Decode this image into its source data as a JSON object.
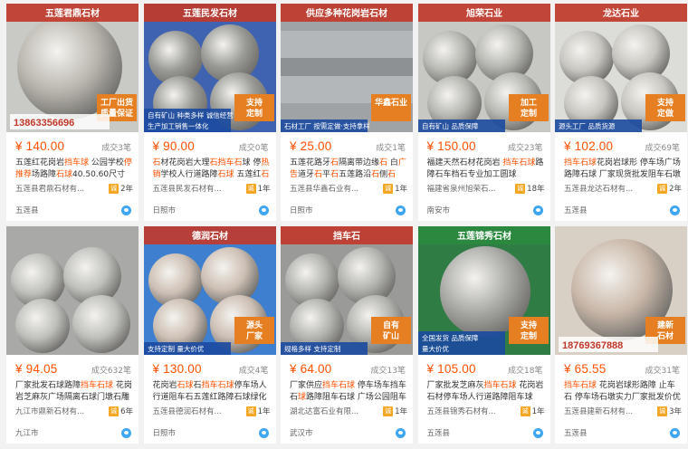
{
  "cards": [
    {
      "price": "¥ 140.00",
      "deals": "成交3笔",
      "title": [
        {
          "t": "五莲红花岗岩"
        },
        {
          "t": "挡车球",
          "h": true
        },
        {
          "t": " 公园学校"
        },
        {
          "t": "停",
          "h": true
        },
        {
          "t": "推荐",
          "h": true
        },
        {
          "t": "场路障"
        },
        {
          "t": "石球",
          "h": true
        },
        {
          "t": "40.50.60尺寸车止"
        },
        {
          "t": "石",
          "h": true
        }
      ],
      "seller": "五莲县君鼎石材有...",
      "years": "2年",
      "location": "五莲县",
      "img": {
        "bg": "#c9c9c6",
        "ball": "#b9b5ae",
        "banner_text": "五莲君鼎石材",
        "tag": "工厂出货\n质量保证",
        "phone": "13863356696"
      }
    },
    {
      "price": "¥ 90.00",
      "deals": "成交0笔",
      "title": [
        {
          "t": "石",
          "h": true
        },
        {
          "t": "材花岗岩大理"
        },
        {
          "t": "石挡车石",
          "h": true
        },
        {
          "t": "球 停"
        },
        {
          "t": "热销",
          "h": true
        },
        {
          "t": "学校人行道路障"
        },
        {
          "t": "石球",
          "h": true
        },
        {
          "t": " 五莲红"
        },
        {
          "t": "石",
          "h": true
        },
        {
          "t": "墩子"
        }
      ],
      "seller": "五莲县民发石材有...",
      "years": "1年",
      "location": "日照市",
      "img": {
        "bg": "#3f63b0",
        "ball": "#9a9a97",
        "banner_text": "五莲民发石材",
        "tag": "支持\n定制",
        "bottom": "自有矿山  种类多样  诚信经营\n生产加工销售一体化"
      }
    },
    {
      "price": "¥ 25.00",
      "deals": "成交1笔",
      "title": [
        {
          "t": "五莲花路牙"
        },
        {
          "t": "石",
          "h": true
        },
        {
          "t": "隔离带边缘"
        },
        {
          "t": "石",
          "h": true
        },
        {
          "t": " 白"
        },
        {
          "t": "广告",
          "h": true
        },
        {
          "t": "道牙"
        },
        {
          "t": "石",
          "h": true
        },
        {
          "t": "平"
        },
        {
          "t": "石",
          "h": true
        },
        {
          "t": "五莲路沿"
        },
        {
          "t": "石",
          "h": true
        },
        {
          "t": "侧"
        },
        {
          "t": "石",
          "h": true
        }
      ],
      "seller": "五莲县华鑫石业有...",
      "years": "1年",
      "location": "日照市",
      "img": {
        "bg": "#9fa3a6",
        "ball": "#8e9194",
        "banner_text": "供应多种花岗岩石材",
        "tag": "华鑫石业",
        "bottom": "石材工厂  按需定做·支持拿样"
      }
    },
    {
      "price": "¥ 150.00",
      "deals": "成交23笔",
      "title": [
        {
          "t": "福建天然石材花岗岩 "
        },
        {
          "t": "挡车",
          "h": true
        },
        {
          "t": "石",
          "h": true
        },
        {
          "t": "球",
          "h": true
        },
        {
          "t": "路障石车档石专业加工圆球"
        }
      ],
      "seller": "福建省泉州旭荣石...",
      "years": "18年",
      "location": "南安市",
      "img": {
        "bg": "#c7c8c4",
        "ball": "#b7b7b2",
        "banner_text": "旭荣石业",
        "tag": "加工\n定制",
        "bottom": "自有矿山  品质保障"
      }
    },
    {
      "price": "¥ 102.00",
      "deals": "成交69笔",
      "title": [
        {
          "t": "挡车石球",
          "h": true
        },
        {
          "t": "花岗岩球形 停车场广场路障石球 厂家现货批发阻车石墩子"
        }
      ],
      "seller": "五莲县龙达石材有...",
      "years": "2年",
      "location": "五莲县",
      "img": {
        "bg": "#dcdcd8",
        "ball": "#c8c6c0",
        "banner_text": "龙达石业",
        "tag": "支持\n定做",
        "bottom": "源头工厂  品质货源"
      }
    },
    {
      "price": "¥ 94.05",
      "deals": "成交632笔",
      "title": [
        {
          "t": "厂家批发石球路障"
        },
        {
          "t": "挡车石球",
          "h": true
        },
        {
          "t": " 花岗岩芝麻灰广场隔离石球门墩石雕批发"
        }
      ],
      "seller": "九江市鼎新石材有...",
      "years": "6年",
      "location": "九江市",
      "img": {
        "bg": "#a9aaa8",
        "ball": "#bfbfbb"
      }
    },
    {
      "price": "¥ 130.00",
      "deals": "成交4笔",
      "title": [
        {
          "t": "花岗岩"
        },
        {
          "t": "石球",
          "h": true
        },
        {
          "t": "石"
        },
        {
          "t": "挡车",
          "h": true
        },
        {
          "t": "石球",
          "h": true
        },
        {
          "t": "停车场人行道阻车石五莲红路障石球绿化石墩摆件路障"
        }
      ],
      "seller": "五莲县德润石材有...",
      "years": "1年",
      "location": "日照市",
      "img": {
        "bg": "#3f7fd0",
        "ball": "#cdbfb4",
        "banner_text": "德润石材",
        "tag": "源头\n厂家",
        "bottom": "支持定制  量大价优"
      }
    },
    {
      "price": "¥ 64.00",
      "deals": "成交13笔",
      "title": [
        {
          "t": "厂家供应"
        },
        {
          "t": "挡车石球",
          "h": true
        },
        {
          "t": " 停车场车挡车石"
        },
        {
          "t": "球",
          "h": true
        },
        {
          "t": "路障阻车石球 广场公园阻车石墩"
        }
      ],
      "seller": "湖北达富石业有限...",
      "years": "1年",
      "location": "武汉市",
      "img": {
        "bg": "#9a9b99",
        "ball": "#b2b2ae",
        "banner_text": "挡车石",
        "tag": "自有\n矿山",
        "bottom": "规格多样  支持定制"
      }
    },
    {
      "price": "¥ 105.00",
      "deals": "成交18笔",
      "title": [
        {
          "t": "厂家批发芝麻灰"
        },
        {
          "t": "挡车石球",
          "h": true
        },
        {
          "t": " 花岗岩石材停车场人行道路障阻车球"
        }
      ],
      "seller": "五莲县锦秀石材有...",
      "years": "1年",
      "location": "五莲县",
      "img": {
        "bg": "#2f7d44",
        "ball": "#a9a9a6",
        "banner_text": "五莲锦秀石材",
        "tag": "支持\n定制",
        "bottom": "全国发货  品质保障\n量大价优"
      }
    },
    {
      "price": "¥ 65.55",
      "deals": "成交31笔",
      "title": [
        {
          "t": "挡车石球",
          "h": true
        },
        {
          "t": " 花岗岩球形路障 止车石 停车场石墩实力厂家批发价优"
        }
      ],
      "seller": "五莲县建新石材有...",
      "years": "3年",
      "location": "五莲县",
      "img": {
        "bg": "#d8cfc5",
        "ball": "#c9b7a8",
        "tag": "建新\n石材",
        "phone": "18769367888"
      }
    }
  ]
}
